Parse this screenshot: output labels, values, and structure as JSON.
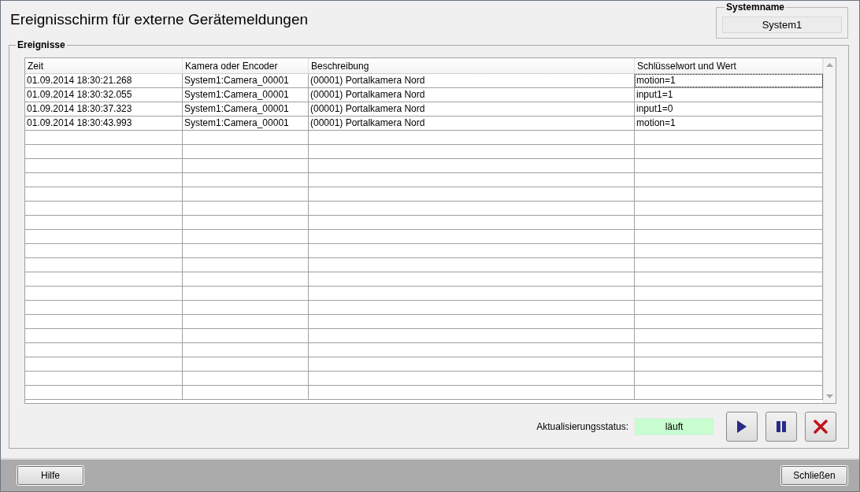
{
  "window": {
    "title": "Ereignisschirm für externe Gerätemeldungen"
  },
  "system": {
    "label": "Systemname",
    "value": "System1"
  },
  "events": {
    "label": "Ereignisse",
    "columns": [
      "Zeit",
      "Kamera oder Encoder",
      "Beschreibung",
      "Schlüsselwort und Wert"
    ],
    "rows": [
      {
        "cells": [
          "01.09.2014 18:30:21.268",
          "System1:Camera_00001",
          "(00001) Portalkamera Nord",
          "motion=1"
        ],
        "focused": true
      },
      {
        "cells": [
          "01.09.2014 18:30:32.055",
          "System1:Camera_00001",
          "(00001) Portalkamera Nord",
          "input1=1"
        ],
        "focused": false
      },
      {
        "cells": [
          "01.09.2014 18:30:37.323",
          "System1:Camera_00001",
          "(00001) Portalkamera Nord",
          "input1=0"
        ],
        "focused": false
      },
      {
        "cells": [
          "01.09.2014 18:30:43.993",
          "System1:Camera_00001",
          "(00001) Portalkamera Nord",
          "motion=1"
        ],
        "focused": false
      }
    ]
  },
  "update_status": {
    "label": "Aktualisierungsstatus:",
    "value": "läuft"
  },
  "controls": [
    {
      "kind": "play"
    },
    {
      "kind": "pause"
    },
    {
      "kind": "stop"
    }
  ],
  "footer": {
    "buttons": [
      "Hilfe",
      "Schließen"
    ]
  }
}
